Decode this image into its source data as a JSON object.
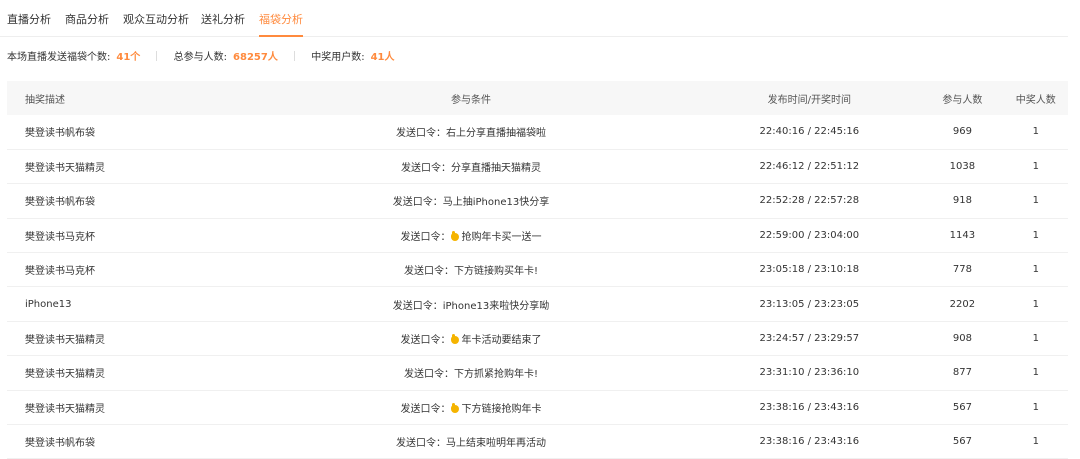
{
  "tabs": [
    {
      "label": "直播分析",
      "active": false
    },
    {
      "label": "商品分析",
      "active": false
    },
    {
      "label": "观众互动分析",
      "active": false
    },
    {
      "label": "送礼分析",
      "active": false
    },
    {
      "label": "福袋分析",
      "active": true
    }
  ],
  "summary": {
    "count_label": "本场直播发送福袋个数:",
    "count_value": "41个",
    "participants_label": "总参与人数:",
    "participants_value": "68257人",
    "winners_label": "中奖用户数:",
    "winners_value": "41人"
  },
  "accent_color": "#ff8a3d",
  "table": {
    "headers": {
      "desc": "抽奖描述",
      "condition": "参与条件",
      "time": "发布时间/开奖时间",
      "participants": "参与人数",
      "winners": "中奖人数"
    },
    "rows": [
      {
        "desc": "樊登读书帆布袋",
        "condition_prefix": "发送口令：",
        "has_icon": false,
        "condition_text": "右上分享直播抽福袋啦",
        "time": "22:40:16 / 22:45:16",
        "participants": "969",
        "winners": "1"
      },
      {
        "desc": "樊登读书天猫精灵",
        "condition_prefix": "发送口令：",
        "has_icon": false,
        "condition_text": "分享直播抽天猫精灵",
        "time": "22:46:12 / 22:51:12",
        "participants": "1038",
        "winners": "1"
      },
      {
        "desc": "樊登读书帆布袋",
        "condition_prefix": "发送口令：",
        "has_icon": false,
        "condition_text": "马上抽iPhone13快分享",
        "time": "22:52:28 / 22:57:28",
        "participants": "918",
        "winners": "1"
      },
      {
        "desc": "樊登读书马克杯",
        "condition_prefix": "发送口令：",
        "has_icon": true,
        "condition_text": "抢购年卡买一送一",
        "time": "22:59:00 / 23:04:00",
        "participants": "1143",
        "winners": "1"
      },
      {
        "desc": "樊登读书马克杯",
        "condition_prefix": "发送口令：",
        "has_icon": false,
        "condition_text": "下方链接购买年卡!",
        "time": "23:05:18 / 23:10:18",
        "participants": "778",
        "winners": "1"
      },
      {
        "desc": "iPhone13",
        "condition_prefix": "发送口令：",
        "has_icon": false,
        "condition_text": "iPhone13来啦快分享呦",
        "time": "23:13:05 / 23:23:05",
        "participants": "2202",
        "winners": "1"
      },
      {
        "desc": "樊登读书天猫精灵",
        "condition_prefix": "发送口令：",
        "has_icon": true,
        "condition_text": "年卡活动要结束了",
        "time": "23:24:57 / 23:29:57",
        "participants": "908",
        "winners": "1"
      },
      {
        "desc": "樊登读书天猫精灵",
        "condition_prefix": "发送口令：",
        "has_icon": false,
        "condition_text": "下方抓紧抢购年卡!",
        "time": "23:31:10 / 23:36:10",
        "participants": "877",
        "winners": "1"
      },
      {
        "desc": "樊登读书天猫精灵",
        "condition_prefix": "发送口令：",
        "has_icon": true,
        "condition_text": "下方链接抢购年卡",
        "time": "23:38:16 / 23:43:16",
        "participants": "567",
        "winners": "1"
      },
      {
        "desc": "樊登读书帆布袋",
        "condition_prefix": "发送口令：",
        "has_icon": false,
        "condition_text": "马上结束啦明年再活动",
        "time": "23:38:16 / 23:43:16",
        "participants": "567",
        "winners": "1"
      }
    ]
  }
}
